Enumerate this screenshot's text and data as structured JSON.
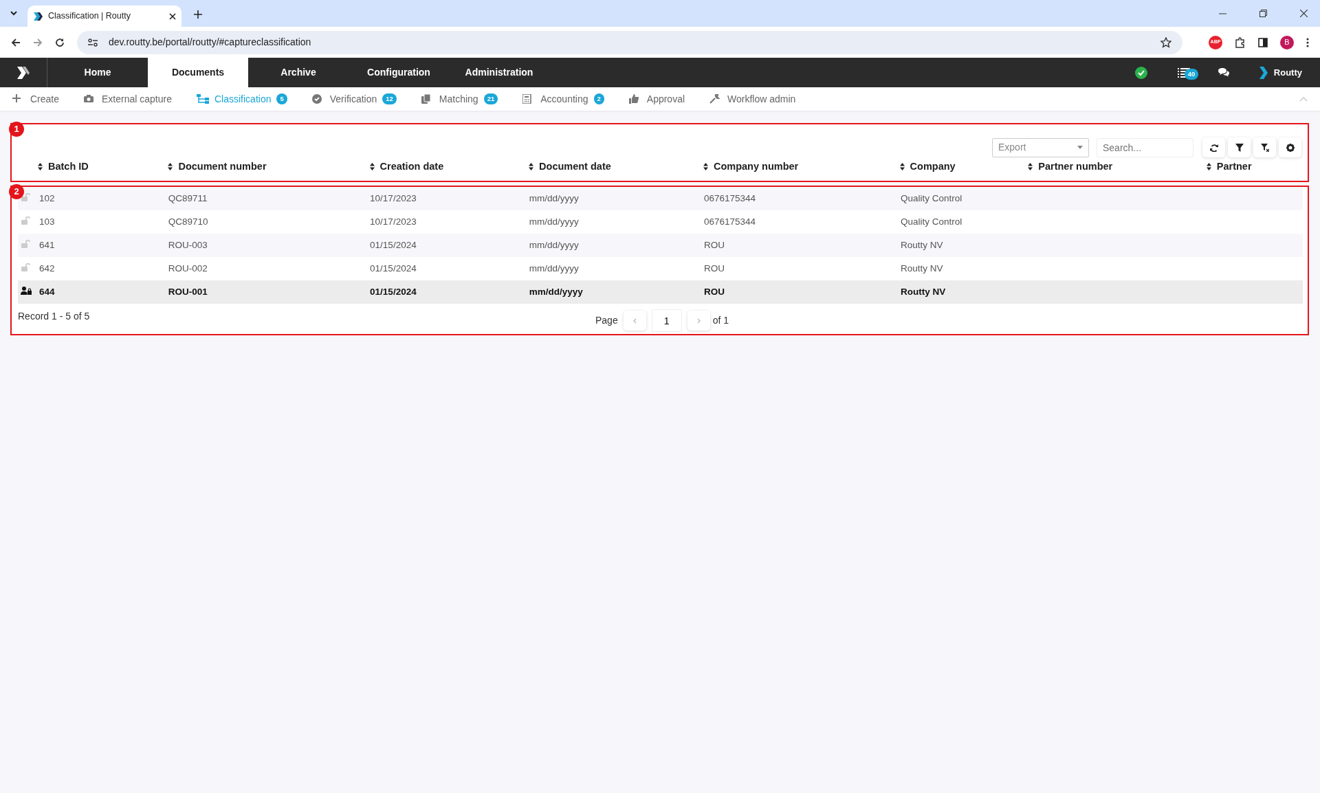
{
  "browser": {
    "tab_title": "Classification | Routty",
    "url": "dev.routty.be/portal/routty/#captureclassification",
    "extension_label": "ABP",
    "profile_initial": "B"
  },
  "app_nav": {
    "items": [
      {
        "label": "Home",
        "selected": false
      },
      {
        "label": "Documents",
        "selected": true
      },
      {
        "label": "Archive",
        "selected": false
      },
      {
        "label": "Configuration",
        "selected": false
      },
      {
        "label": "Administration",
        "selected": false
      }
    ],
    "task_count": "40",
    "user": "Routty"
  },
  "sub_nav": [
    {
      "label": "Create",
      "selected": false
    },
    {
      "label": "External capture",
      "selected": false
    },
    {
      "label": "Classification",
      "badge": "5",
      "selected": true
    },
    {
      "label": "Verification",
      "badge": "12",
      "selected": false
    },
    {
      "label": "Matching",
      "badge": "21",
      "selected": false
    },
    {
      "label": "Accounting",
      "badge": "2",
      "selected": false
    },
    {
      "label": "Approval",
      "selected": false
    },
    {
      "label": "Workflow admin",
      "selected": false
    }
  ],
  "toolbar": {
    "export_placeholder": "Export",
    "search_placeholder": "Search..."
  },
  "table": {
    "columns": [
      "Batch ID",
      "Document number",
      "Creation date",
      "Document date",
      "Company number",
      "Company",
      "Partner number",
      "Partner"
    ],
    "rows": [
      {
        "cells": [
          "102",
          "QC89711",
          "10/17/2023",
          "mm/dd/yyyy",
          "0676175344",
          "Quality Control",
          "",
          ""
        ],
        "locked": false,
        "selected": false
      },
      {
        "cells": [
          "103",
          "QC89710",
          "10/17/2023",
          "mm/dd/yyyy",
          "0676175344",
          "Quality Control",
          "",
          ""
        ],
        "locked": false,
        "selected": false
      },
      {
        "cells": [
          "641",
          "ROU-003",
          "01/15/2024",
          "mm/dd/yyyy",
          "ROU",
          "Routty NV",
          "",
          ""
        ],
        "locked": false,
        "selected": false
      },
      {
        "cells": [
          "642",
          "ROU-002",
          "01/15/2024",
          "mm/dd/yyyy",
          "ROU",
          "Routty NV",
          "",
          ""
        ],
        "locked": false,
        "selected": false
      },
      {
        "cells": [
          "644",
          "ROU-001",
          "01/15/2024",
          "mm/dd/yyyy",
          "ROU",
          "Routty NV",
          "",
          ""
        ],
        "locked": true,
        "selected": true
      }
    ]
  },
  "footer": {
    "record_text": "Record 1 - 5 of 5",
    "page_label": "Page",
    "page": "1",
    "page_total": "of 1"
  },
  "annotations": [
    "1",
    "2"
  ]
}
